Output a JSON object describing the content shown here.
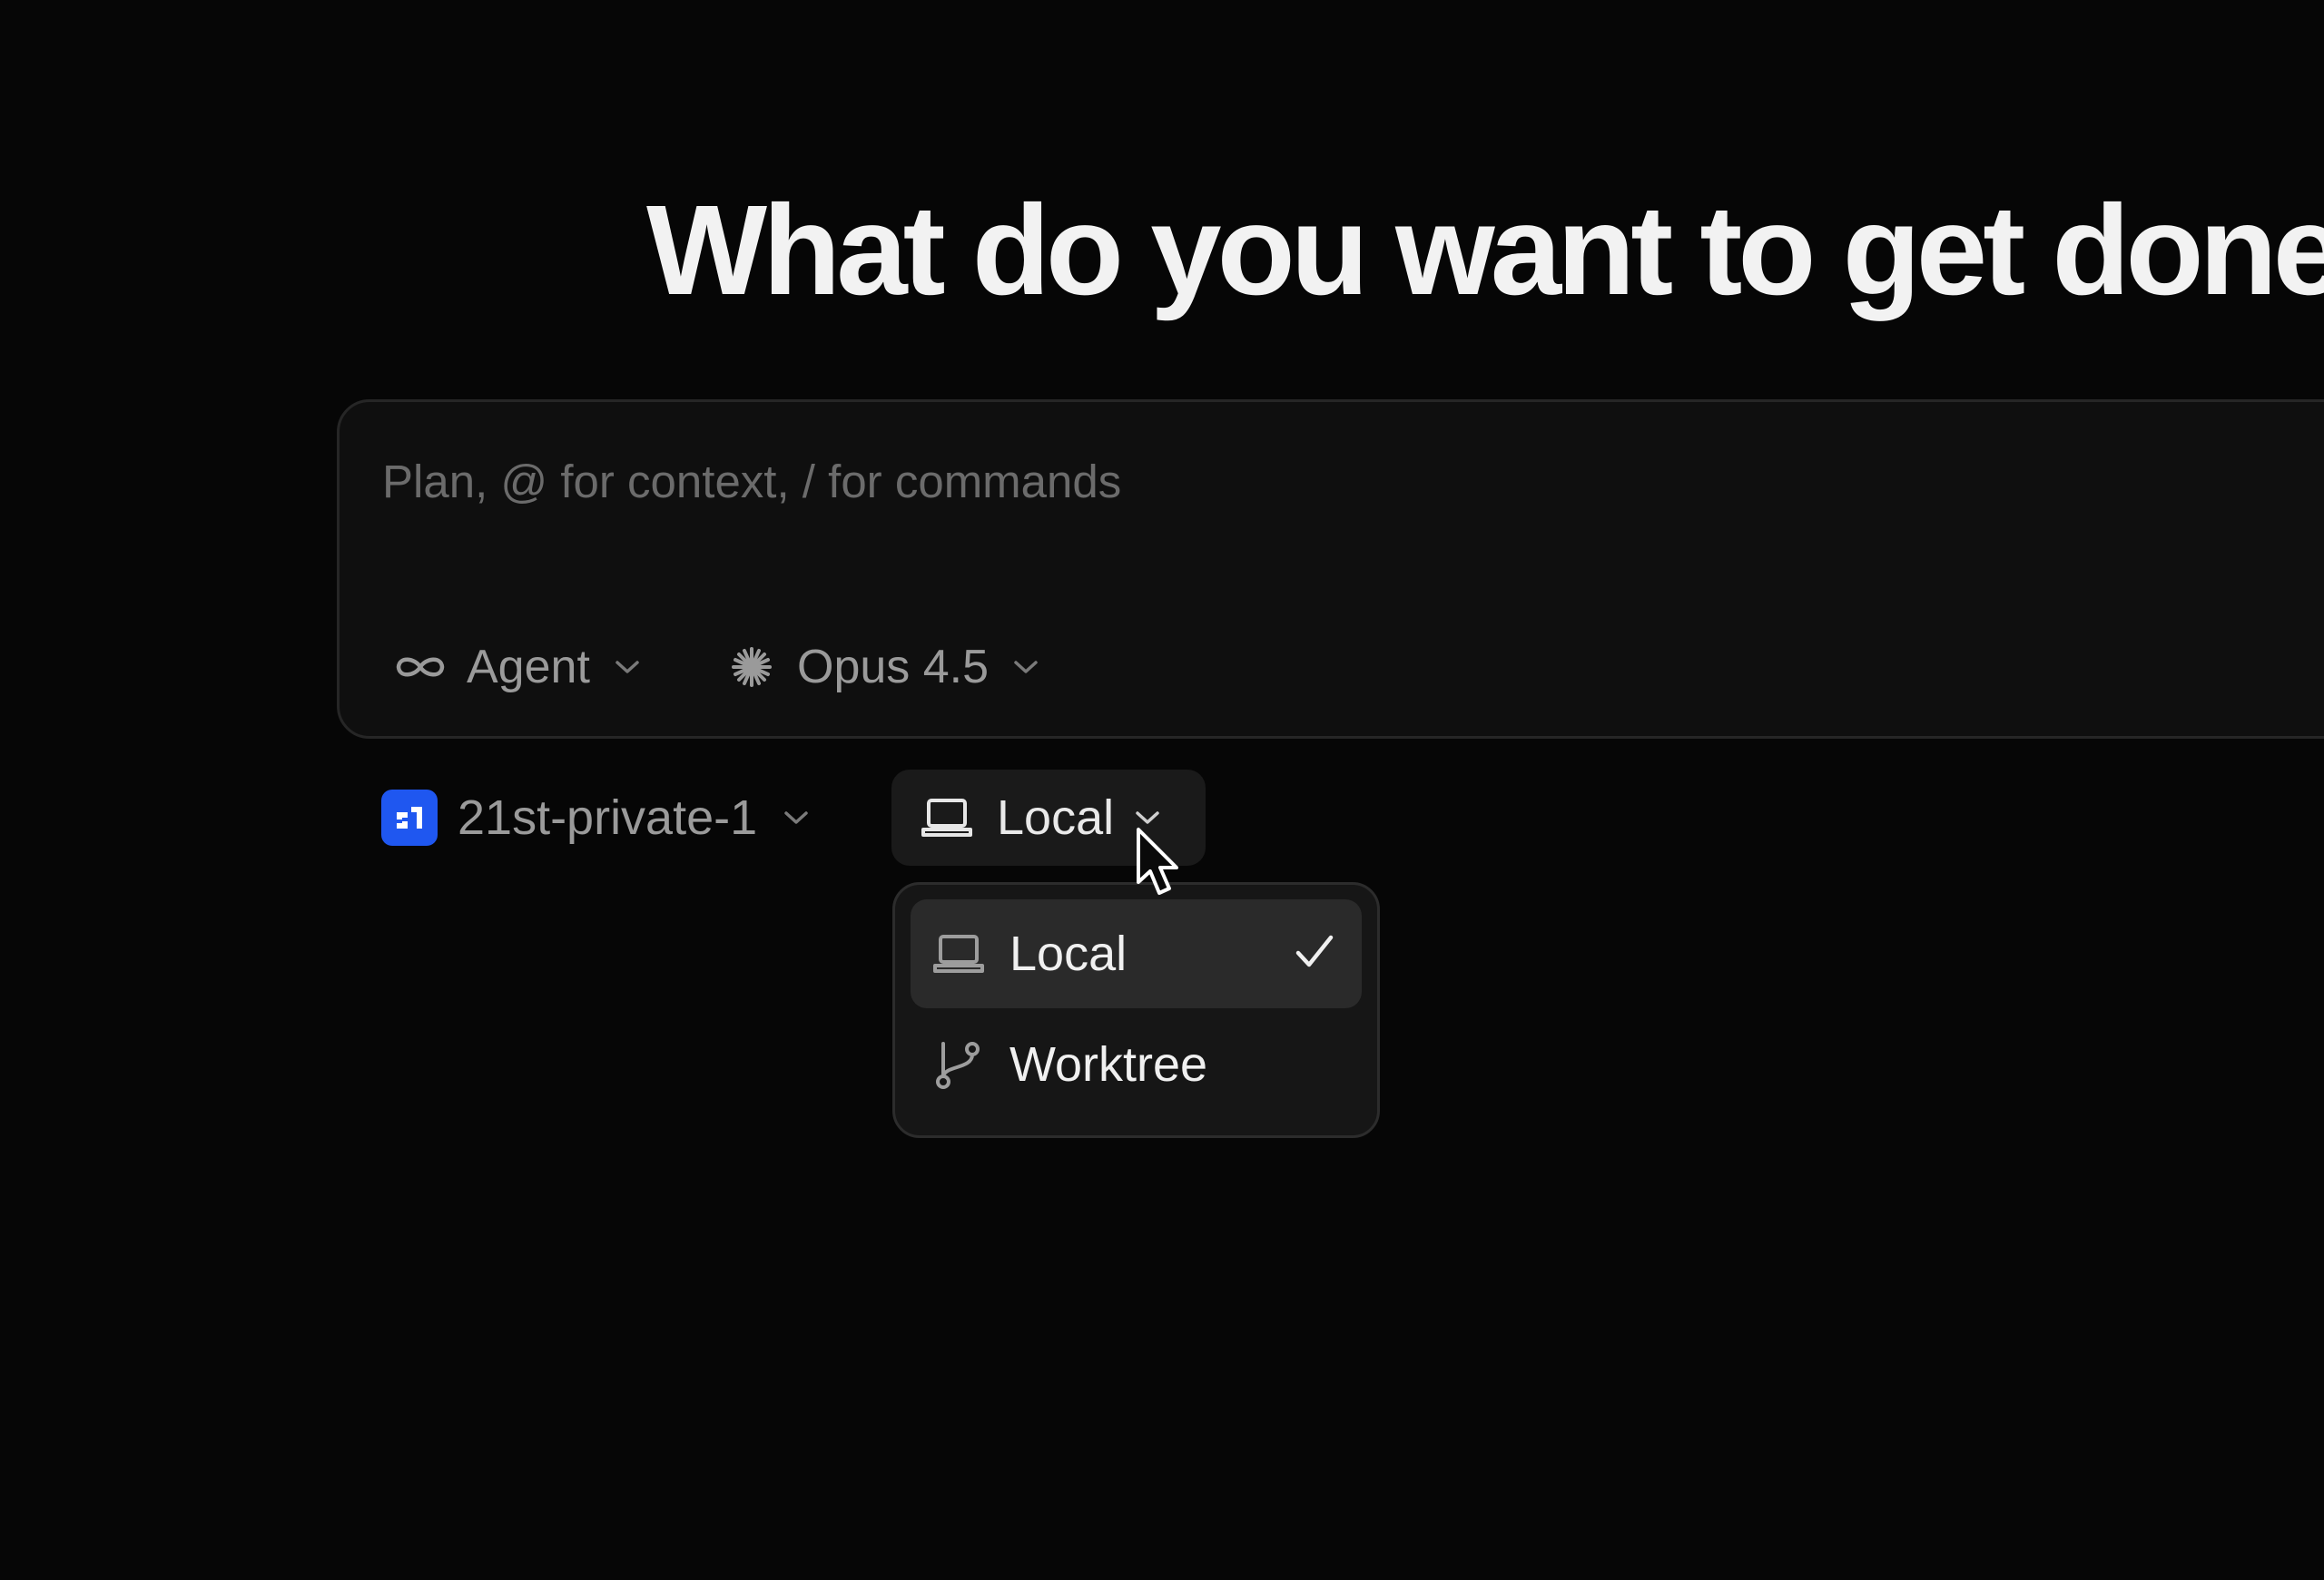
{
  "headline": "What do you want to get done?",
  "composer": {
    "placeholder": "Plan, @ for context, / for commands",
    "value": "",
    "mode": {
      "label": "Agent",
      "icon": "infinity-icon"
    },
    "model": {
      "label": "Opus 4.5",
      "icon": "sparkle-icon"
    }
  },
  "repo": {
    "label": "21st-private-1",
    "badge_color": "#1f57f0",
    "icon": "repo-logo-icon"
  },
  "environment": {
    "selected_label": "Local",
    "icon": "laptop-icon",
    "menu": [
      {
        "label": "Local",
        "icon": "laptop-icon",
        "selected": true
      },
      {
        "label": "Worktree",
        "icon": "git-branch-icon",
        "selected": false
      }
    ]
  },
  "colors": {
    "background": "#060606",
    "composer_bg": "#0f0f0f",
    "accent": "#1f57f0"
  }
}
